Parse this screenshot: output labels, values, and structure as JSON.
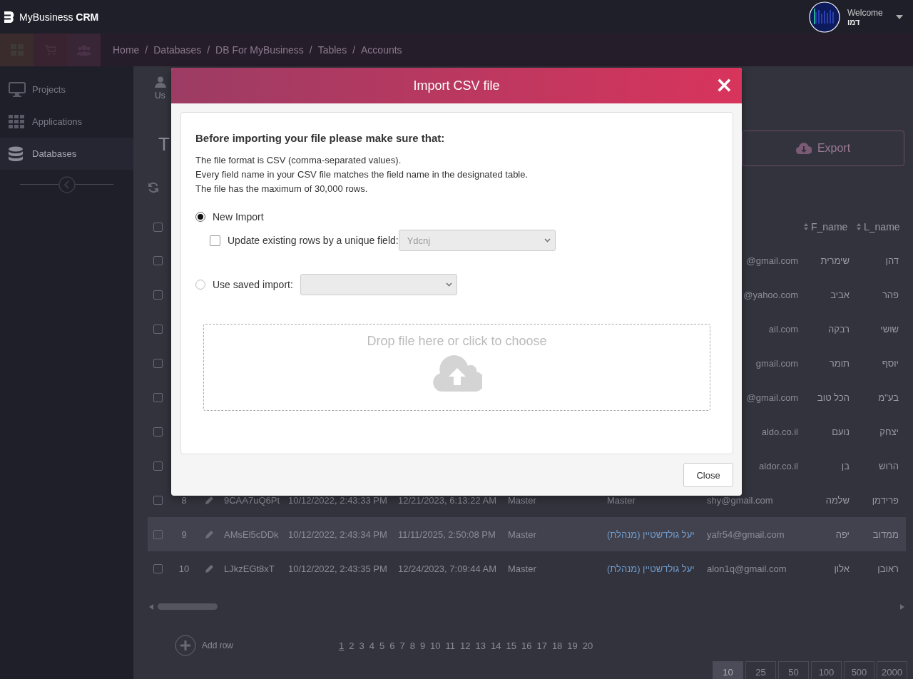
{
  "header": {
    "logo": "MyBusiness **CRM**",
    "greeting": "Welcome",
    "user_name": "דמו"
  },
  "breadcrumbs": {
    "separator": "/",
    "items": [
      "Home",
      "Databases",
      "DB For MyBusiness",
      "Tables",
      "Accounts"
    ]
  },
  "sidebar": {
    "items": [
      {
        "label": "Projects",
        "kind": "monitor",
        "selected": false
      },
      {
        "label": "Applications",
        "kind": "grid",
        "selected": false
      },
      {
        "label": "Databases",
        "kind": "database",
        "selected": true
      }
    ]
  },
  "page": {
    "tab_label": "Us",
    "title": "T",
    "export_button": "Export"
  },
  "table": {
    "select_all": {
      "checked": false
    },
    "columns": [
      "F_name",
      "L_name"
    ],
    "rows": [
      {
        "email": "@gmail.com",
        "f_name": "שימרית",
        "l_name": "דהן",
        "hovered": false
      },
      {
        "email": "@yahoo.com",
        "f_name": "אביב",
        "l_name": "פהר",
        "hovered": false
      },
      {
        "email": "ail.com",
        "f_name": "רבקה",
        "l_name": "שושי",
        "hovered": false
      },
      {
        "email": "gmail.com",
        "f_name": "תומר",
        "l_name": "יוסף",
        "hovered": false
      },
      {
        "email": "@gmail.com",
        "f_name": "הכל טוב",
        "l_name": "בע\"מ",
        "hovered": false
      },
      {
        "email": "aldo.co.il",
        "f_name": "נועם",
        "l_name": "יצחק",
        "hovered": false
      },
      {
        "email": "aldor.co.il",
        "f_name": "בן",
        "l_name": "הרוש",
        "hovered": false
      },
      {
        "number": "8",
        "id": "9CAA7uQ6Pt",
        "created": "10/12/2022, 2:43:33 PM",
        "updated": "12/21/2023, 6:13:22 AM",
        "column_5": "Master",
        "column_6": {
          "text": "Master",
          "link": false
        },
        "email": "shy@gmail.com",
        "f_name": "שלמה",
        "l_name": "פרידמן",
        "hovered": false
      },
      {
        "number": "9",
        "id": "AMsEl5cDDk",
        "created": "10/12/2022, 2:43:34 PM",
        "updated": "11/11/2025, 2:50:08 PM",
        "column_5": "Master",
        "column_6": {
          "text": "יעל גולדשטיין (מנהלת)",
          "link": true
        },
        "email": "yafr54@gmail.com",
        "f_name": "יפה",
        "l_name": "ממדוב",
        "hovered": true
      },
      {
        "number": "10",
        "id": "LJkzEGt8xT",
        "created": "10/12/2022, 2:43:35 PM",
        "updated": "12/24/2023, 7:09:44 AM",
        "column_5": "Master",
        "column_6": {
          "text": "יעל גולדשטיין (מנהלת)",
          "link": true
        },
        "email": "alon1q@gmail.com",
        "f_name": "אלון",
        "l_name": "ראובן",
        "hovered": false
      }
    ]
  },
  "add_row": "Add row",
  "pagination": [
    {
      "label": "1",
      "selected": true
    },
    {
      "label": "2",
      "selected": false
    },
    {
      "label": "3",
      "selected": false
    },
    {
      "label": "4",
      "selected": false
    },
    {
      "label": "5",
      "selected": false
    },
    {
      "label": "6",
      "selected": false
    },
    {
      "label": "7",
      "selected": false
    },
    {
      "label": "8",
      "selected": false
    },
    {
      "label": "9",
      "selected": false
    },
    {
      "label": "10",
      "selected": false
    },
    {
      "label": "11",
      "selected": false
    },
    {
      "label": "12",
      "selected": false
    },
    {
      "label": "13",
      "selected": false
    },
    {
      "label": "14",
      "selected": false
    },
    {
      "label": "15",
      "selected": false
    },
    {
      "label": "16",
      "selected": false
    },
    {
      "label": "17",
      "selected": false
    },
    {
      "label": "18",
      "selected": false
    },
    {
      "label": "19",
      "selected": false
    },
    {
      "label": "20",
      "selected": false
    }
  ],
  "page_sizes": [
    {
      "label": "10",
      "selected": true
    },
    {
      "label": "25",
      "selected": false
    },
    {
      "label": "50",
      "selected": false
    },
    {
      "label": "100",
      "selected": false
    },
    {
      "label": "500",
      "selected": false
    },
    {
      "label": "2000",
      "selected": false
    }
  ],
  "modal": {
    "title": "Import CSV file",
    "close_glyph": "×",
    "heading": "Before importing your file please make sure that:",
    "lines": [
      "The file format is CSV (comma-separated values).",
      "Every field name in your CSV file matches the field name in the designated table.",
      "The file has the maximum of 30,000 rows."
    ],
    "new_import": {
      "label": "New Import",
      "selected": true
    },
    "update_rows": {
      "label": "Update existing rows by a unique field:",
      "checked": false,
      "field": {
        "value": "Ydcnj",
        "disabled": true
      }
    },
    "saved_import": {
      "label": "Use saved import:",
      "selected": false
    },
    "drop_zone": "Drop file here or click to choose",
    "close_button": "Close"
  }
}
